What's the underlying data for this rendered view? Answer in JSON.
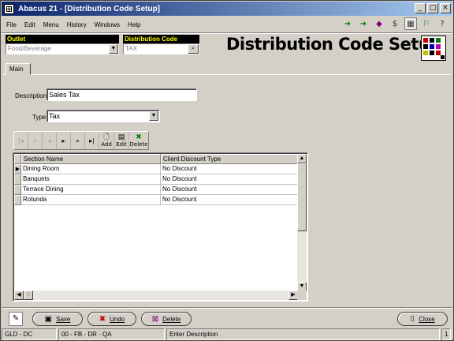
{
  "window": {
    "title": "Abacus 21 - [Distribution Code Setup]",
    "controls": [
      "_",
      "□",
      "×"
    ]
  },
  "menu": [
    "File",
    "Edit",
    "Menu",
    "History",
    "Windows",
    "Help"
  ],
  "toolbar_icons": [
    "back-arrow-icon",
    "forward-arrow-icon",
    "gem-icon",
    "dollar-icon",
    "calculator-icon",
    "running-man-icon",
    "help-question-icon"
  ],
  "header": {
    "outlet_label": "Outlet",
    "outlet_value": "Food/Beverage",
    "dist_code_label": "Distribution Code",
    "dist_code_value": "TAX",
    "page_title": "Distribution Code Setup"
  },
  "tabs": [
    {
      "label": "Main",
      "active": true
    }
  ],
  "form": {
    "description_label": "Description",
    "description_value": "Sales Tax",
    "type_label": "Type",
    "type_value": "Tax"
  },
  "navigator": {
    "add_label": "Add",
    "edit_label": "Edit",
    "delete_label": "Delete"
  },
  "grid": {
    "columns": [
      "Section Name",
      "Client Discount Type"
    ],
    "rows": [
      [
        "Dining Room",
        "No Discount"
      ],
      [
        "Banquets",
        "No Discount"
      ],
      [
        "Terrace Dining",
        "No Discount"
      ],
      [
        "Rotunda",
        "No Discount"
      ]
    ]
  },
  "buttons": {
    "save": "Save",
    "undo": "Undo",
    "delete": "Delete",
    "close": "Close"
  },
  "statusbar": [
    "GLD - DC",
    "00 - FB - DR - QA",
    "Enter Description",
    "1"
  ],
  "colors": {
    "title_gradient_start": "#0a246a",
    "title_gradient_end": "#a6caf0",
    "field_label_bg": "#000000",
    "field_label_fg": "#ffff00",
    "face": "#d4d0c8"
  }
}
